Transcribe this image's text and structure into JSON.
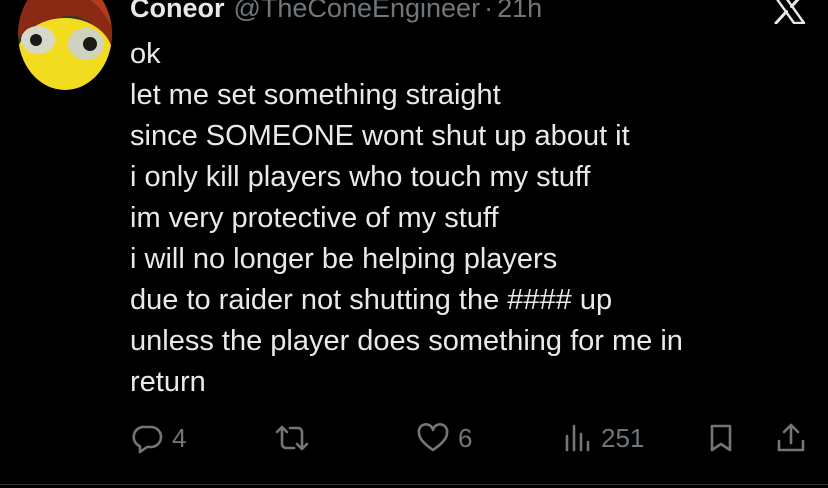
{
  "tweet": {
    "display_name": "Coneor",
    "handle": "@TheConeEngineer",
    "separator": "·",
    "time": "21h",
    "lines": [
      "ok",
      "let me set something straight",
      "since SOMEONE wont shut up about it",
      "i only kill players who touch my stuff",
      "im very protective of my stuff",
      "i will no longer be helping players",
      "due to raider not shutting the #### up",
      "unless the player does something for me in",
      "return"
    ]
  },
  "actions": {
    "reply_count": "4",
    "repost_count": "",
    "like_count": "6",
    "views_count": "251"
  },
  "icons": {
    "brand": "x-logo-icon",
    "reply": "reply-icon",
    "repost": "repost-icon",
    "like": "heart-icon",
    "views": "views-icon",
    "bookmark": "bookmark-icon",
    "share": "share-icon"
  },
  "colors": {
    "background": "#000000",
    "text": "#e7e9ea",
    "muted": "#71767b",
    "avatar_yellow": "#f2dc1f",
    "avatar_red": "#b43a1a"
  }
}
